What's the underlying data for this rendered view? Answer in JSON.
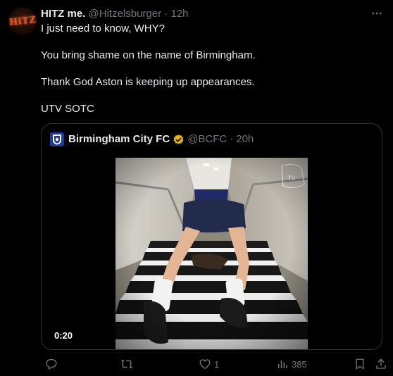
{
  "tweet": {
    "avatar_text": "HiTZ",
    "display_name": "HITZ me.",
    "handle": "@Hitzelsburger",
    "separator": "·",
    "time": "12h",
    "more_icon": "more-icon",
    "lines": [
      "I just need to know, WHY?",
      "You bring shame on the name of Birmingham.",
      "Thank God Aston is keeping up appearances.",
      "UTV SOTC"
    ]
  },
  "quote": {
    "display_name": "Birmingham City FC",
    "handle": "@BCFC",
    "separator": "·",
    "time": "20h",
    "verified_color": "#e8b30c",
    "logo_color": "#1c3d9c",
    "video": {
      "duration": "0:20",
      "watermark": "TV"
    }
  },
  "actions": {
    "reply": {
      "icon": "reply-icon",
      "count": ""
    },
    "repost": {
      "icon": "repost-icon",
      "count": ""
    },
    "like": {
      "icon": "like-icon",
      "count": "1"
    },
    "views": {
      "icon": "views-icon",
      "count": "385"
    },
    "bookmark": {
      "icon": "bookmark-icon"
    },
    "share": {
      "icon": "share-icon"
    }
  }
}
